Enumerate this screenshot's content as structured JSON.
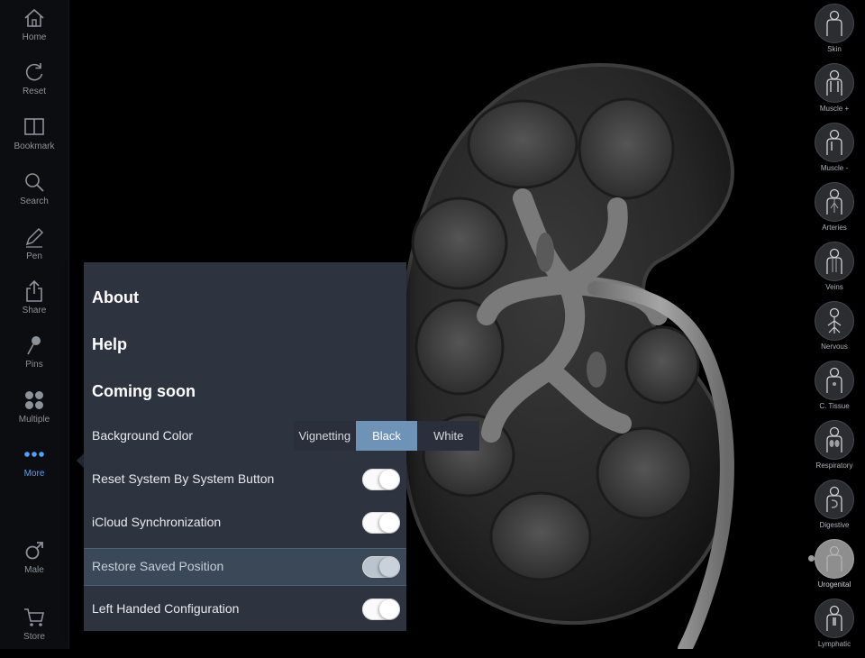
{
  "toolbar": {
    "items": [
      {
        "id": "home",
        "label": "Home",
        "icon": "home-icon"
      },
      {
        "id": "reset",
        "label": "Reset",
        "icon": "reset-icon"
      },
      {
        "id": "bookmark",
        "label": "Bookmark",
        "icon": "bookmark-icon"
      },
      {
        "id": "search",
        "label": "Search",
        "icon": "search-icon"
      },
      {
        "id": "pen",
        "label": "Pen",
        "icon": "pen-icon"
      },
      {
        "id": "share",
        "label": "Share",
        "icon": "share-icon"
      },
      {
        "id": "pins",
        "label": "Pins",
        "icon": "pin-icon"
      },
      {
        "id": "multiple",
        "label": "Multiple",
        "icon": "multiple-icon"
      },
      {
        "id": "more",
        "label": "More",
        "icon": "more-icon",
        "active": true
      },
      {
        "id": "male",
        "label": "Male",
        "icon": "male-icon"
      },
      {
        "id": "store",
        "label": "Store",
        "icon": "cart-icon"
      }
    ],
    "active_color": "#4fa3ff"
  },
  "systems": {
    "items": [
      {
        "id": "skin",
        "label": "Skin"
      },
      {
        "id": "muscle-plus",
        "label": "Muscle +"
      },
      {
        "id": "muscle-minus",
        "label": "Muscle -"
      },
      {
        "id": "arteries",
        "label": "Arteries"
      },
      {
        "id": "veins",
        "label": "Veins"
      },
      {
        "id": "nervous",
        "label": "Nervous"
      },
      {
        "id": "tissue",
        "label": "C. Tissue"
      },
      {
        "id": "respiratory",
        "label": "Respiratory"
      },
      {
        "id": "digestive",
        "label": "Digestive"
      },
      {
        "id": "urogenital",
        "label": "Urogenital",
        "selected": true
      },
      {
        "id": "lymphatic",
        "label": "Lymphatic"
      }
    ]
  },
  "menu": {
    "headers": {
      "about": "About",
      "help": "Help",
      "coming_soon": "Coming soon"
    },
    "background_color": {
      "label": "Background Color",
      "options": [
        "Vignetting",
        "Black",
        "White"
      ],
      "selected": "Black"
    },
    "settings": [
      {
        "id": "reset-system",
        "label": "Reset System By System Button",
        "on": true
      },
      {
        "id": "icloud",
        "label": "iCloud Synchronization",
        "on": true
      },
      {
        "id": "restore-position",
        "label": "Restore Saved Position",
        "on": true,
        "highlighted": true
      },
      {
        "id": "left-handed",
        "label": "Left Handed Configuration",
        "on": true
      }
    ],
    "panel_color": "#2e3340",
    "segment_active_color": "#6f93b6"
  }
}
